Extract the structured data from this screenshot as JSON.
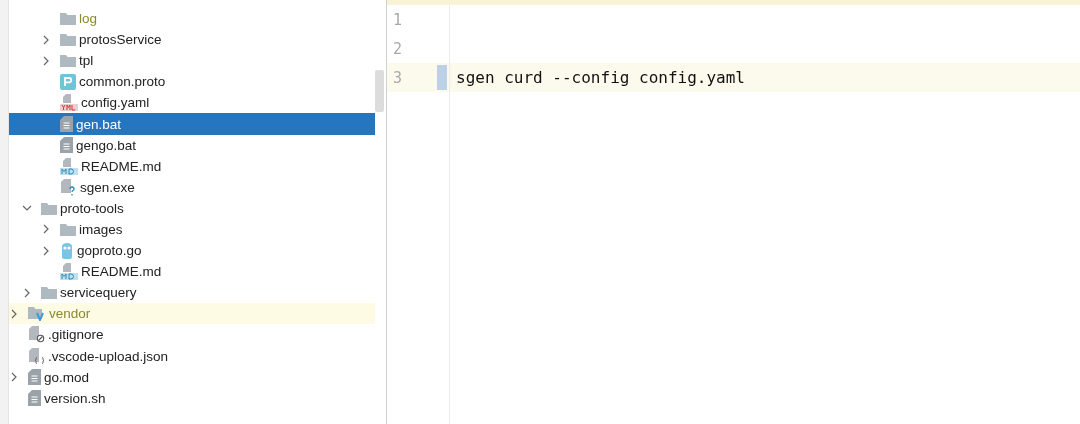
{
  "project_tree": {
    "items": [
      {
        "children": [
          {
            "children": [
              {
                "label": "log",
                "kind": "folder",
                "selected": false,
                "ignored": true,
                "highlighted": false
              },
              {
                "label": "protosService",
                "kind": "folder",
                "expanded": false,
                "selected": false,
                "ignored": false,
                "highlighted": false
              },
              {
                "label": "tpl",
                "kind": "folder",
                "expanded": false,
                "selected": false,
                "ignored": false,
                "highlighted": false
              },
              {
                "label": "common.proto",
                "kind": "proto",
                "selected": false,
                "ignored": false,
                "highlighted": false
              },
              {
                "label": "config.yaml",
                "kind": "yaml",
                "selected": false,
                "ignored": false,
                "highlighted": false
              },
              {
                "label": "gen.bat",
                "kind": "text",
                "selected": true,
                "ignored": false,
                "highlighted": false
              },
              {
                "label": "gengo.bat",
                "kind": "text",
                "selected": false,
                "ignored": false,
                "highlighted": false
              },
              {
                "label": "README.md",
                "kind": "markdown",
                "selected": false,
                "ignored": false,
                "highlighted": false
              },
              {
                "label": "sgen.exe",
                "kind": "unknown",
                "selected": false,
                "ignored": false,
                "highlighted": false
              }
            ]
          },
          {
            "label": "proto-tools",
            "kind": "folder",
            "expanded": true,
            "selected": false,
            "ignored": false,
            "highlighted": false,
            "children": [
              {
                "label": "images",
                "kind": "folder",
                "expanded": false,
                "selected": false,
                "ignored": false,
                "highlighted": false
              },
              {
                "label": "goproto.go",
                "kind": "gopher",
                "expanded": false,
                "selected": false,
                "ignored": false,
                "highlighted": false
              },
              {
                "label": "README.md",
                "kind": "markdown",
                "selected": false,
                "ignored": false,
                "highlighted": false
              }
            ]
          },
          {
            "label": "servicequery",
            "kind": "folder",
            "expanded": false,
            "selected": false,
            "ignored": false,
            "highlighted": false
          }
        ]
      },
      {
        "label": "vendor",
        "kind": "vendor",
        "expanded": false,
        "selected": false,
        "ignored": true,
        "highlighted": true
      },
      {
        "label": ".gitignore",
        "kind": "ignore",
        "selected": false,
        "ignored": false,
        "highlighted": false
      },
      {
        "label": ".vscode-upload.json",
        "kind": "json",
        "selected": false,
        "ignored": false,
        "highlighted": false
      },
      {
        "label": "go.mod",
        "kind": "text",
        "expanded": false,
        "selected": false,
        "ignored": false,
        "highlighted": false
      },
      {
        "label": "version.sh",
        "kind": "text",
        "selected": false,
        "ignored": false,
        "highlighted": false
      }
    ]
  },
  "editor": {
    "lines": [
      {
        "number": "1",
        "current": false,
        "changed": false
      },
      {
        "number": "2",
        "current": false,
        "changed": false
      },
      {
        "number": "3",
        "text": "sgen curd --config config.yaml",
        "current": true,
        "changed": true
      }
    ]
  }
}
